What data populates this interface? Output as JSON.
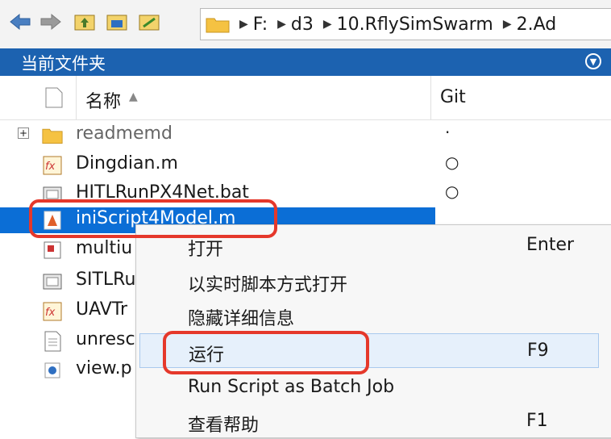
{
  "breadcrumb": [
    "F:",
    "d3",
    "10.RflySimSwarm",
    "2.Ad"
  ],
  "panel": {
    "title": "当前文件夹"
  },
  "columns": {
    "name": "名称",
    "git": "Git"
  },
  "files": [
    {
      "name": "readmemd",
      "git": "·"
    },
    {
      "name": "Dingdian.m",
      "git": "○"
    },
    {
      "name": "HITLRunPX4Net.bat",
      "git": "○"
    },
    {
      "name": "iniScript4Model.m",
      "git": "○"
    },
    {
      "name": "multiu",
      "git": ""
    },
    {
      "name": "SITLRu",
      "git": ""
    },
    {
      "name": "UAVTr",
      "git": ""
    },
    {
      "name": "unresc",
      "git": ""
    },
    {
      "name": "view.p",
      "git": ""
    }
  ],
  "context_menu": [
    {
      "label": "打开",
      "shortcut": "Enter"
    },
    {
      "label": "以实时脚本方式打开",
      "shortcut": ""
    },
    {
      "label": "隐藏详细信息",
      "shortcut": ""
    },
    {
      "label": "运行",
      "shortcut": "F9"
    },
    {
      "label": "Run Script as Batch Job",
      "shortcut": ""
    },
    {
      "label": "查看帮助",
      "shortcut": "F1"
    }
  ],
  "colors": {
    "accent": "#1c62b0",
    "selection": "#0b6ed6",
    "highlight_box": "#e5382b"
  }
}
